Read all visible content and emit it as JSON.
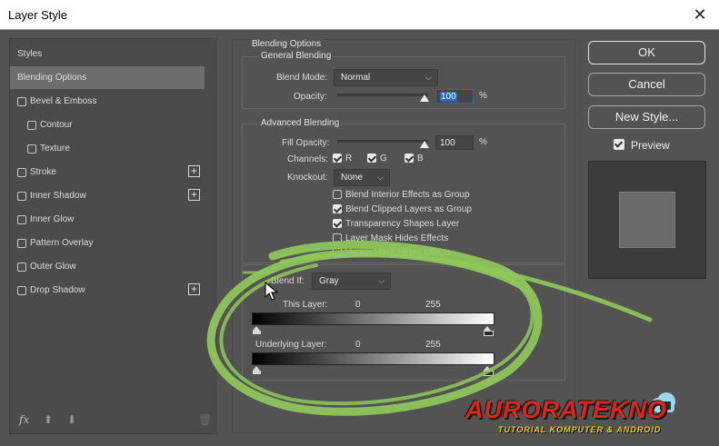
{
  "window": {
    "title": "Layer Style",
    "close_glyph": "✕"
  },
  "styles_panel": {
    "items": [
      {
        "label": "Styles",
        "checkbox": false,
        "checked": false,
        "plus": false,
        "indent": 0,
        "active": false
      },
      {
        "label": "Blending Options",
        "checkbox": false,
        "checked": false,
        "plus": false,
        "indent": 0,
        "active": true
      },
      {
        "label": "Bevel & Emboss",
        "checkbox": true,
        "checked": false,
        "plus": false,
        "indent": 0,
        "active": false
      },
      {
        "label": "Contour",
        "checkbox": true,
        "checked": false,
        "plus": false,
        "indent": 1,
        "active": false
      },
      {
        "label": "Texture",
        "checkbox": true,
        "checked": false,
        "plus": false,
        "indent": 1,
        "active": false
      },
      {
        "label": "Stroke",
        "checkbox": true,
        "checked": false,
        "plus": true,
        "indent": 0,
        "active": false
      },
      {
        "label": "Inner Shadow",
        "checkbox": true,
        "checked": false,
        "plus": true,
        "indent": 0,
        "active": false
      },
      {
        "label": "Inner Glow",
        "checkbox": true,
        "checked": false,
        "plus": false,
        "indent": 0,
        "active": false
      },
      {
        "label": "Pattern Overlay",
        "checkbox": true,
        "checked": false,
        "plus": false,
        "indent": 0,
        "active": false
      },
      {
        "label": "Outer Glow",
        "checkbox": true,
        "checked": false,
        "plus": false,
        "indent": 0,
        "active": false
      },
      {
        "label": "Drop Shadow",
        "checkbox": true,
        "checked": false,
        "plus": true,
        "indent": 0,
        "active": false
      }
    ],
    "plus_glyph": "+",
    "footer": {
      "fx": "fx",
      "up_glyph": "⬆",
      "down_glyph": "⬇",
      "trash_glyph": "🗑"
    }
  },
  "blending_options": {
    "section_title": "Blending Options",
    "general": {
      "title": "General Blending",
      "blend_mode_label": "Blend Mode:",
      "blend_mode_value": "Normal",
      "opacity_label": "Opacity:",
      "opacity_value": "100",
      "opacity_unit": "%",
      "opacity_fraction": 1.0
    },
    "advanced": {
      "title": "Advanced Blending",
      "fill_opacity_label": "Fill Opacity:",
      "fill_opacity_value": "100",
      "fill_opacity_unit": "%",
      "fill_opacity_fraction": 1.0,
      "channels_label": "Channels:",
      "channels": [
        {
          "label": "R",
          "checked": true
        },
        {
          "label": "G",
          "checked": true
        },
        {
          "label": "B",
          "checked": true
        }
      ],
      "knockout_label": "Knockout:",
      "knockout_value": "None",
      "options": [
        {
          "label": "Blend Interior Effects as Group",
          "checked": false
        },
        {
          "label": "Blend Clipped Layers as Group",
          "checked": true
        },
        {
          "label": "Transparency Shapes Layer",
          "checked": true
        },
        {
          "label": "Layer Mask Hides Effects",
          "checked": false
        },
        {
          "label": "Vector Mask Hides Effects",
          "checked": false
        }
      ]
    },
    "blend_if": {
      "label": "Blend If:",
      "value": "Gray",
      "this_layer_label": "This Layer:",
      "this_layer_min": "0",
      "this_layer_max": "255",
      "underlying_label": "Underlying Layer:",
      "underlying_min": "0",
      "underlying_max": "255"
    }
  },
  "buttons": {
    "ok": "OK",
    "cancel": "Cancel",
    "new_style": "New Style..."
  },
  "preview": {
    "label": "Preview",
    "checked": true
  },
  "chevron_glyph": "⌵",
  "watermark": {
    "title": "AURORATEKNO",
    "subtitle": "TUTORIAL KOMPUTER & ANDROID"
  },
  "colors": {
    "dialog_bg": "#535353",
    "annotation": "#8fc95a",
    "watermark_red": "#e2231a",
    "watermark_yellow": "#f5d400",
    "focus_blue": "#2a6ab5"
  }
}
